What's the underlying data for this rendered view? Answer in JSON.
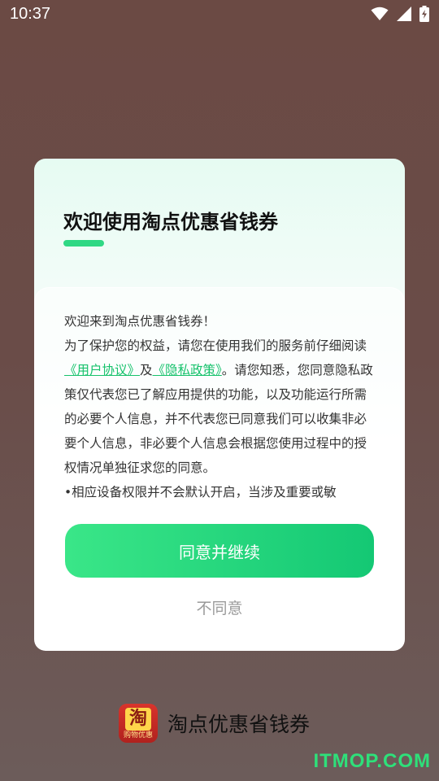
{
  "status_bar": {
    "time": "10:37",
    "icons": [
      "wifi-icon",
      "signal-icon",
      "battery-charging-icon"
    ]
  },
  "dialog": {
    "title": "欢迎使用淘点优惠省钱券",
    "greeting": "欢迎来到淘点优惠省钱券！",
    "body_before_links": "为了保护您的权益，请您在使用我们的服务前仔细阅读",
    "user_agreement_link": "《用户协议》",
    "and_text": "及",
    "privacy_policy_link": "《隐私政策》",
    "body_after_links": "。请您知悉，您同意隐私政策仅代表您已了解应用提供的功能，以及功能运行所需的必要个人信息，并不代表您已同意我们可以收集非必要个人信息，非必要个人信息会根据您使用过程中的授权情况单独征求您的同意。",
    "body_cutoff": "•相应设备权限并不会默认开启，当涉及重要或敏",
    "agree_button": "同意并继续",
    "disagree_button": "不同意"
  },
  "brand": {
    "logo_char": "淘",
    "logo_sub": "购物优惠",
    "name": "淘点优惠省钱券"
  },
  "watermark": "ITMOP.COM",
  "colors": {
    "accent": "#17c26c",
    "button_start": "#3ae688",
    "button_end": "#14c874"
  }
}
